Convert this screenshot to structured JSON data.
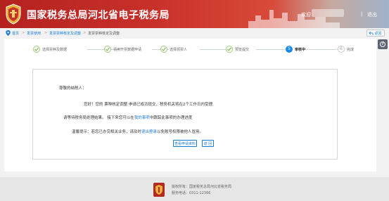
{
  "header": {
    "site_title": "国家税务总局河北省电子税务局",
    "welcome_text": "欢迎",
    "separator": "|",
    "logout_label": "退出"
  },
  "breadcrumb": {
    "items": [
      "首页",
      "发票使用",
      "发票票种核定及调整",
      "发票票种核定及调整"
    ],
    "separator": ">"
  },
  "back_label": "返回",
  "help_icon": "?",
  "steps": [
    {
      "label": "选择票种及数据",
      "state": "done"
    },
    {
      "label": "领用开票数据申请",
      "state": "done"
    },
    {
      "label": "选择领票人",
      "state": "done"
    },
    {
      "label": "预览提交",
      "state": "done"
    },
    {
      "label": "审核中",
      "state": "active",
      "number": "5"
    },
    {
      "label": "完成",
      "state": "todo",
      "number": "6"
    }
  ],
  "message": {
    "greeting": "尊敬的纳税人：",
    "line1": "您好！您的 票种核定调整 申请已成功提交，税务机关将在2个工作日内受理.",
    "line2_pre": "请等待税务局处理结果。 接下来您可以在",
    "line2_link": "我的事项",
    "line2_post": "中跟踪此事项的办理进度",
    "line3_pre": "温馨提示：若您已办完相关业务，请及时",
    "line3_link": "退出登录",
    "line3_post": "以免账号权限被他人冒用。"
  },
  "buttons": {
    "view_materials": "查看申请资料",
    "return": "返 回"
  },
  "footer": {
    "copyright": "版权所有：国家税务总局河北省税务局",
    "hotline": "服务电话：0311-12366"
  },
  "colors": {
    "header_red": "#c8312a",
    "link_blue": "#1a7ad6",
    "step_done_green": "#9ccf7a",
    "step_active_blue": "#1a8ae6"
  },
  "icons": {
    "logo": "tax-emblem-icon",
    "home": "location-pin-icon",
    "back": "return-arrow-icon",
    "help": "question-icon",
    "step_done": "check-icon"
  }
}
